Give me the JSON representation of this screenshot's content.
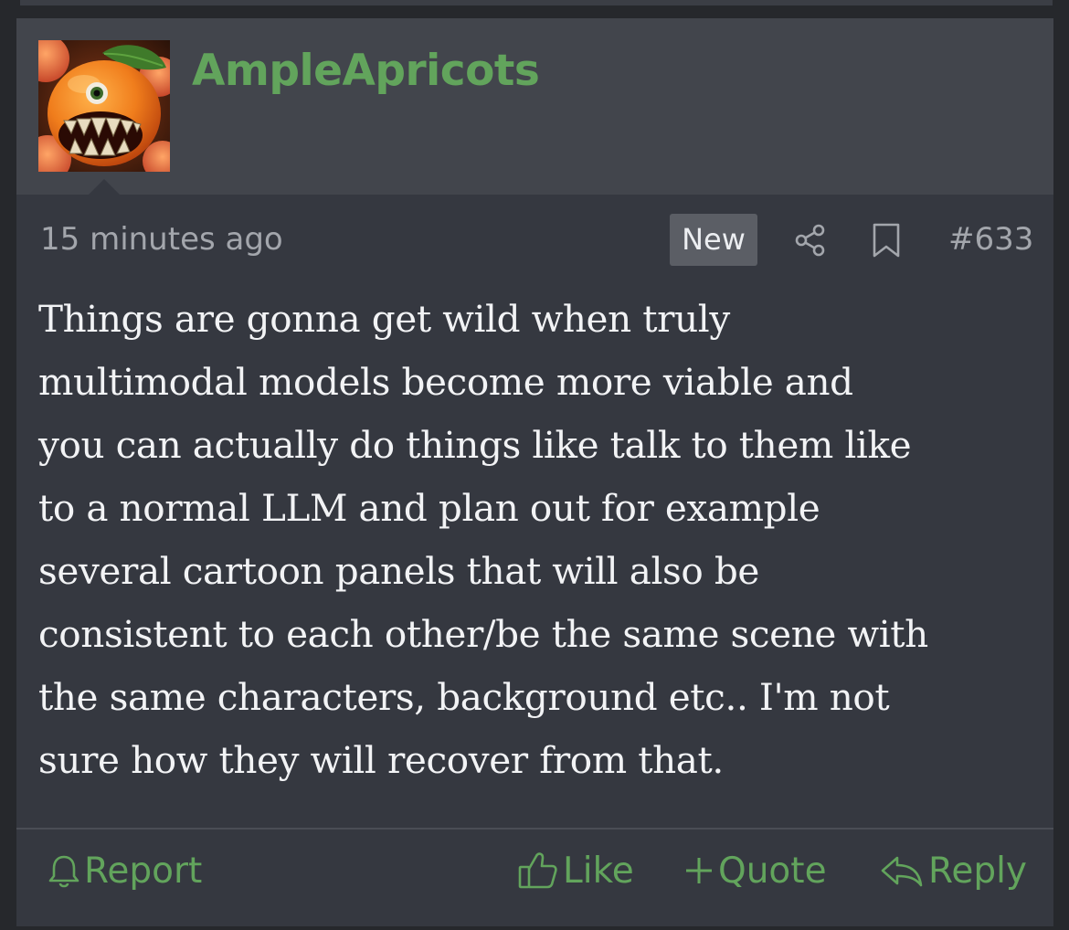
{
  "post": {
    "username": "AmpleApricots",
    "timestamp": "15 minutes ago",
    "badge": "New",
    "number": "#633",
    "body": "Things are gonna get wild when truly\nmultimodal models become more viable and\nyou can actually do things like talk to them like\nto a normal LLM and plan out for example\nseveral cartoon panels that will also be\nconsistent to each other/be the same scene with\nthe same characters, background etc.. I'm not\nsure how they will recover from that."
  },
  "actions": {
    "report": "Report",
    "like": "Like",
    "quote": "Quote",
    "reply": "Reply"
  },
  "icons": {
    "avatar": "apricot-monster-avatar",
    "share": "share-icon",
    "bookmark": "bookmark-icon",
    "report": "bell-icon",
    "like": "thumbs-up-icon",
    "quote": "plus-icon",
    "reply": "reply-icon"
  },
  "colors": {
    "accent": "#62a45c",
    "page_bg": "#26282c",
    "post_bg": "#353840",
    "header_bg": "#42454c",
    "badge_bg": "#5b5e65",
    "text": "#f2f3f5",
    "muted": "#a3a6ac"
  }
}
